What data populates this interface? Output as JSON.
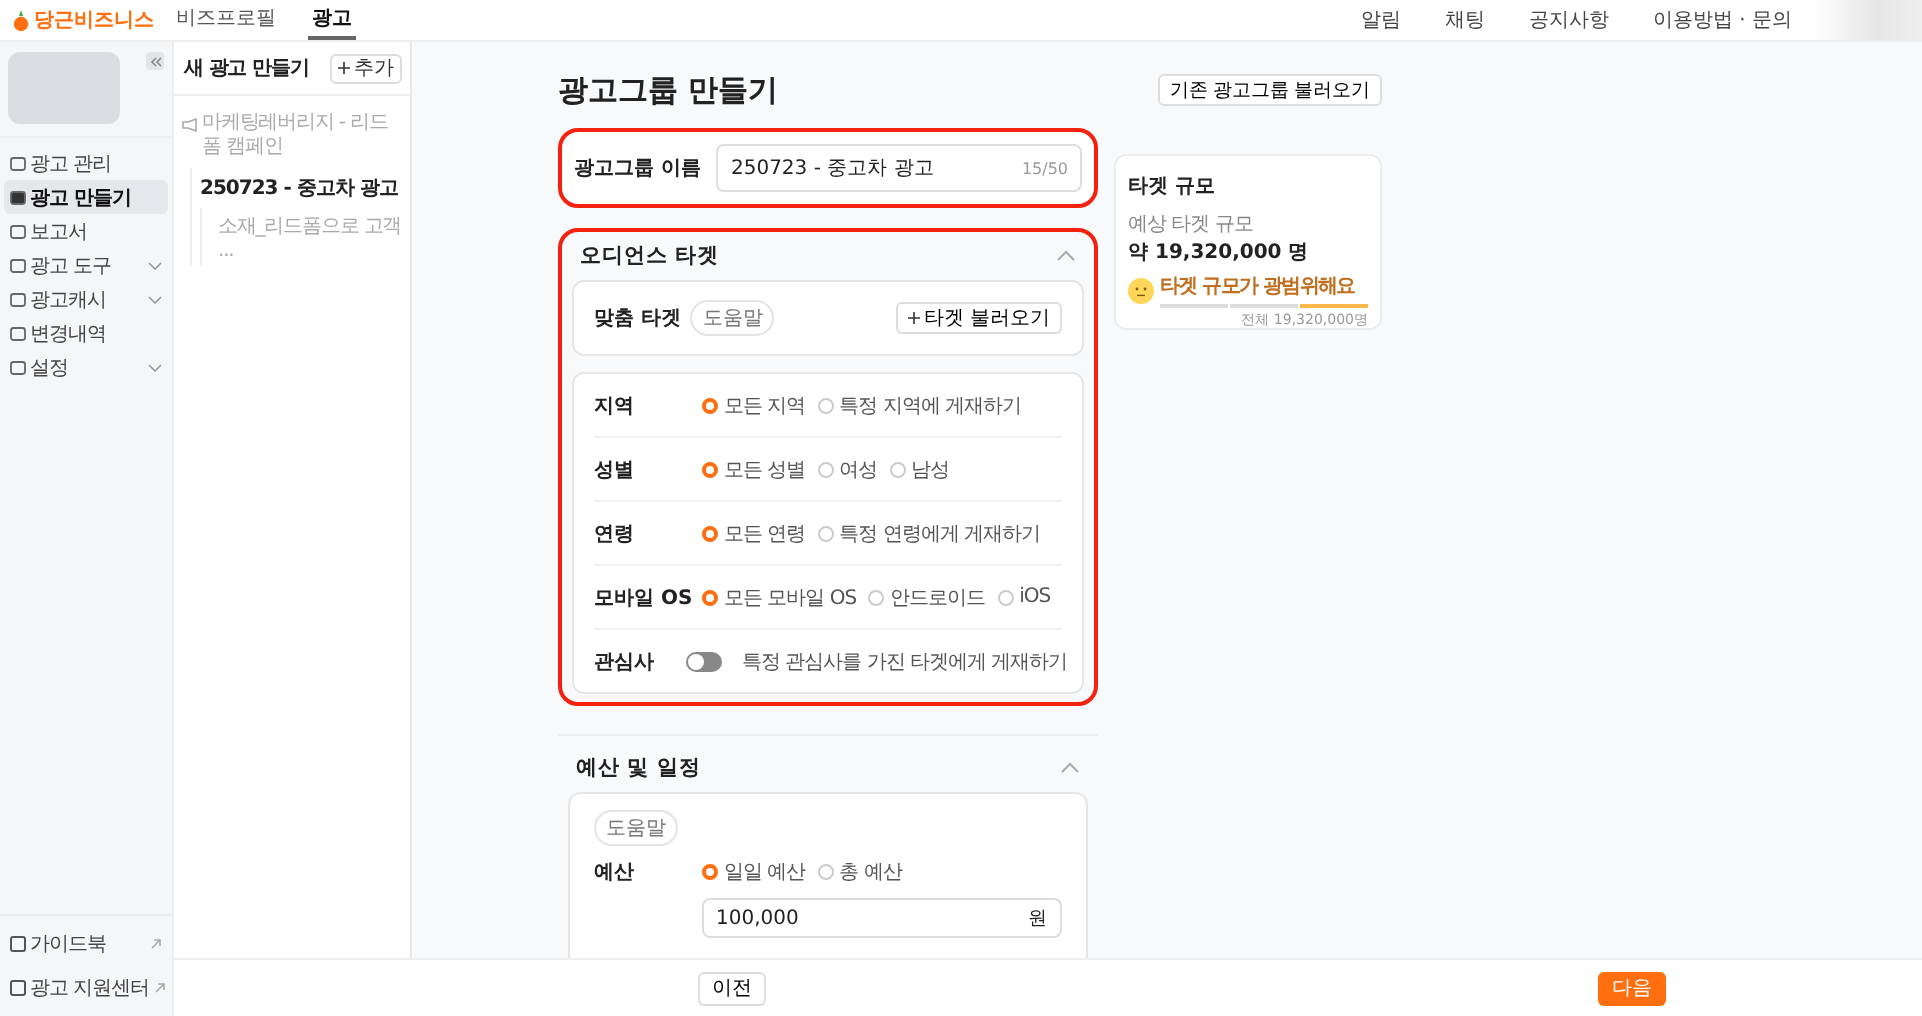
{
  "topbar": {
    "logo": "당근비즈니스",
    "nav": [
      {
        "label": "비즈프로필",
        "selected": false
      },
      {
        "label": "광고",
        "selected": true
      }
    ],
    "links": [
      "알림",
      "채팅",
      "공지사항",
      "이용방법 · 문의"
    ]
  },
  "sidebar": {
    "items": [
      {
        "label": "광고 관리",
        "selected": false,
        "expandable": false
      },
      {
        "label": "광고 만들기",
        "selected": true,
        "expandable": false
      },
      {
        "label": "보고서",
        "selected": false,
        "expandable": false
      },
      {
        "label": "광고 도구",
        "selected": false,
        "expandable": true
      },
      {
        "label": "광고캐시",
        "selected": false,
        "expandable": true
      },
      {
        "label": "변경내역",
        "selected": false,
        "expandable": false
      },
      {
        "label": "설정",
        "selected": false,
        "expandable": true
      }
    ],
    "footer": [
      "가이드북",
      "광고 지원센터"
    ]
  },
  "creation_panel": {
    "title": "새 광고 만들기",
    "add_button": "추가",
    "campaign": {
      "label": "마케팅레버리지 - 리드폼 캠페인",
      "children": [
        {
          "label": "250723 - 중고차 광고",
          "selected": true,
          "children": [
            {
              "label": "소재_리드폼으로 고객 ...",
              "selected": false
            }
          ]
        }
      ]
    }
  },
  "main": {
    "title": "광고그룹 만들기",
    "import_button": "기존 광고그룹 불러오기",
    "name_field": {
      "label": "광고그룹 이름",
      "value": "250723 - 중고차 광고",
      "counter": "15/50",
      "highlighted": true
    },
    "audience": {
      "title": "오디언스 타겟",
      "expanded": true,
      "highlighted": true,
      "custom_target": {
        "label": "맞춤 타겟",
        "help": "도움말",
        "button": "타겟 불러오기"
      },
      "rows": [
        {
          "kind": "radio",
          "label": "지역",
          "options": [
            {
              "label": "모든 지역",
              "selected": true
            },
            {
              "label": "특정 지역에 게재하기",
              "selected": false
            }
          ]
        },
        {
          "kind": "radio",
          "label": "성별",
          "options": [
            {
              "label": "모든 성별",
              "selected": true
            },
            {
              "label": "여성",
              "selected": false
            },
            {
              "label": "남성",
              "selected": false
            }
          ]
        },
        {
          "kind": "radio",
          "label": "연령",
          "options": [
            {
              "label": "모든 연령",
              "selected": true
            },
            {
              "label": "특정 연령에게 게재하기",
              "selected": false
            }
          ]
        },
        {
          "kind": "radio",
          "label": "모바일 OS",
          "options": [
            {
              "label": "모든 모바일 OS",
              "selected": true
            },
            {
              "label": "안드로이드",
              "selected": false
            },
            {
              "label": "iOS",
              "selected": false
            }
          ]
        },
        {
          "kind": "toggle",
          "label": "관심사",
          "on": false,
          "text": "특정 관심사를 가진 타겟에게 게재하기"
        }
      ]
    },
    "budget": {
      "title": "예산 및 일정",
      "expanded": true,
      "help": "도움말",
      "label": "예산",
      "options": [
        {
          "label": "일일 예산",
          "selected": true
        },
        {
          "label": "총 예산",
          "selected": false
        }
      ],
      "value": "100,000",
      "unit": "원"
    }
  },
  "target_panel": {
    "title": "타겟 규모",
    "caption": "예상 타겟 규모",
    "value": "약 19,320,000 명",
    "status": "타겟 규모가 광범위해요",
    "gauge": [
      {
        "selected": false
      },
      {
        "selected": false
      },
      {
        "selected": true
      }
    ],
    "total": "전체 19,320,000명"
  },
  "footer": {
    "prev": "이전",
    "next": "다음"
  }
}
